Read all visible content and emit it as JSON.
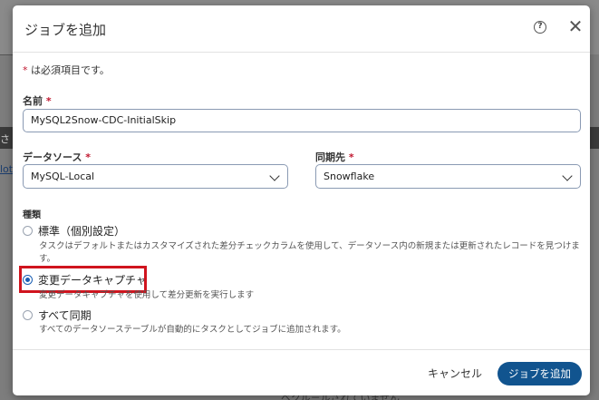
{
  "background": {
    "frag_left_1": "さ",
    "frag_link": "lot",
    "frag_bottom": "ベクル－ルされていません"
  },
  "dialog": {
    "title": "ジョブを追加",
    "required_star": "*",
    "required_note": " は必須項目です。",
    "name": {
      "label": "名前",
      "value": "MySQL2Snow-CDC-InitialSkip"
    },
    "datasource": {
      "label": "データソース",
      "value": "MySQL-Local"
    },
    "sync_target": {
      "label": "同期先",
      "value": "Snowflake"
    },
    "type": {
      "label": "種類",
      "options": [
        {
          "label": "標準（個別設定）",
          "description": "タスクはデフォルトまたはカスタマイズされた差分チェックカラムを使用して、データソース内の新規または更新されたレコードを見つけます。",
          "selected": false
        },
        {
          "label": "変更データキャプチャ",
          "description": "変更データキャプチャを使用して差分更新を実行します",
          "selected": true
        },
        {
          "label": "すべて同期",
          "description": "すべてのデータソーステーブルが自動的にタスクとしてジョブに追加されます。",
          "selected": false
        }
      ]
    },
    "cancel_label": "キャンセル",
    "submit_label": "ジョブを追加"
  },
  "colors": {
    "accent": "#11548f",
    "highlight": "#d0141e",
    "required": "#c0162e"
  },
  "icons": {
    "help": "question-circle-icon",
    "close": "close-icon"
  }
}
